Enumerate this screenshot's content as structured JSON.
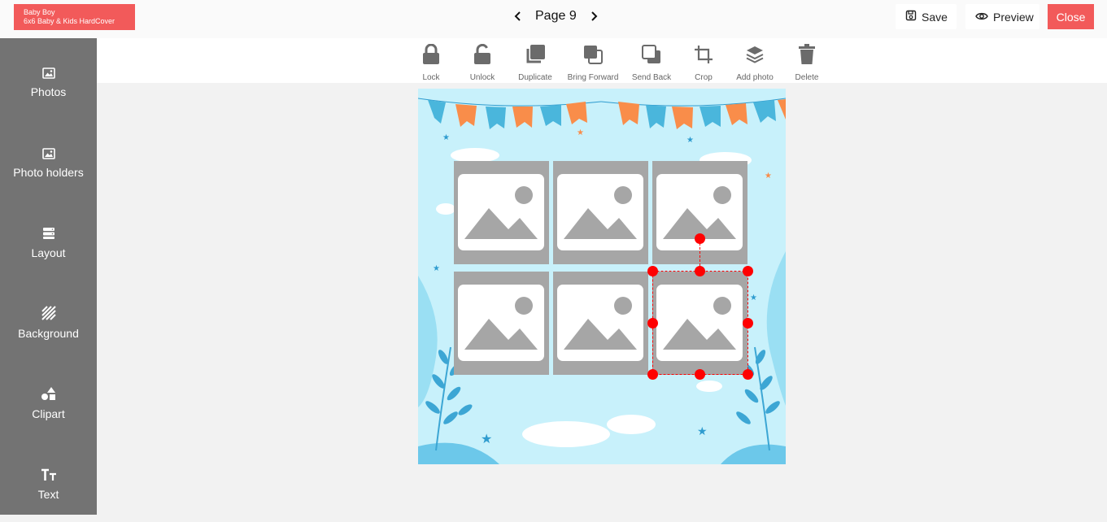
{
  "product": {
    "line1": "Baby Boy",
    "line2": "6x6 Baby & Kids HardCover"
  },
  "page_nav": {
    "label": "Page 9",
    "prev_icon": "chevron-left-icon",
    "next_icon": "chevron-right-icon"
  },
  "actions": {
    "save": "Save",
    "preview": "Preview",
    "close": "Close"
  },
  "colors": {
    "accent": "#f25a5a",
    "sidebar": "#737373",
    "canvas_bg": "#c8f1fb",
    "selection": "#ff0000",
    "placeholder": "#a6a6a6"
  },
  "sidebar": {
    "items": [
      {
        "label": "Photos",
        "icon": "image-icon"
      },
      {
        "label": "Photo holders",
        "icon": "image-icon"
      },
      {
        "label": "Layout",
        "icon": "layout-icon"
      },
      {
        "label": "Background",
        "icon": "pattern-icon"
      },
      {
        "label": "Clipart",
        "icon": "shapes-icon"
      },
      {
        "label": "Text",
        "icon": "text-size-icon"
      }
    ]
  },
  "toolbar": {
    "items": [
      {
        "label": "Lock",
        "icon": "lock-icon"
      },
      {
        "label": "Unlock",
        "icon": "unlock-icon"
      },
      {
        "label": "Duplicate",
        "icon": "duplicate-icon"
      },
      {
        "label": "Bring Forward",
        "icon": "bring-forward-icon"
      },
      {
        "label": "Send Back",
        "icon": "send-back-icon"
      },
      {
        "label": "Crop",
        "icon": "crop-icon"
      },
      {
        "label": "Add photo",
        "icon": "layers-icon"
      },
      {
        "label": "Delete",
        "icon": "trash-icon"
      }
    ]
  },
  "canvas": {
    "photo_holders": 6,
    "selected_holder": 6
  }
}
